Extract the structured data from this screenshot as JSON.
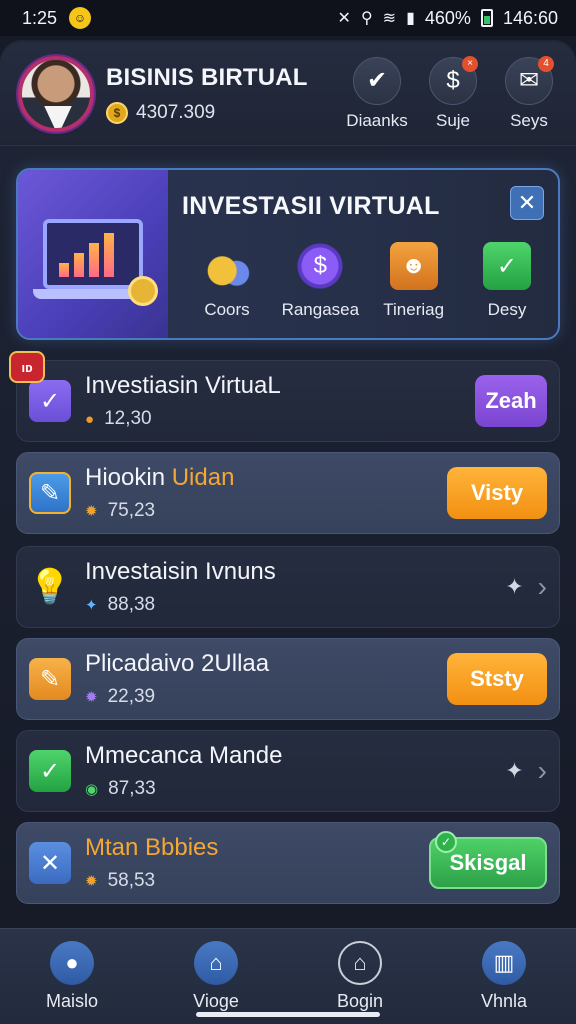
{
  "status_bar": {
    "time_left": "1:25",
    "battery_percent": "460%",
    "time_right": "146:60"
  },
  "header": {
    "name": "BISINIS BIRTUAL",
    "balance": "4307.309",
    "actions": [
      {
        "label": "Diaanks",
        "icon": "check-icon"
      },
      {
        "label": "Suje",
        "icon": "chat-dollar-icon"
      },
      {
        "label": "Seys",
        "icon": "message-icon"
      }
    ]
  },
  "banner": {
    "title": "INVESTASII VIRTUAL",
    "items": [
      {
        "label": "Coors",
        "icon": "coins-icon"
      },
      {
        "label": "Rangasea",
        "icon": "dollar-badge-icon"
      },
      {
        "label": "Tineriag",
        "icon": "person-icon"
      },
      {
        "label": "Desy",
        "icon": "checkmark-icon"
      }
    ]
  },
  "tasks": [
    {
      "title": "Investiasin VirtuaL",
      "value": "12,30",
      "button": "Zeah",
      "corner_badge": "ıᴅ"
    },
    {
      "title_main": "Hiookin ",
      "title_accent": "Uidan",
      "value": "75,23",
      "button": "Visty"
    },
    {
      "title": "Investaisin Ivnuns",
      "value": "88,38"
    },
    {
      "title": "Plicadaivo 2Ullaa",
      "value": "22,39",
      "button": "Ststy"
    },
    {
      "title": "Mmecanca Mande",
      "value": "87,33"
    },
    {
      "title": "Mtan Bbbies",
      "value": "58,53",
      "button": "Skisgal"
    }
  ],
  "bottom_nav": [
    {
      "label": "Maislo",
      "icon": "globe-icon"
    },
    {
      "label": "Vioge",
      "icon": "home-icon"
    },
    {
      "label": "Bogin",
      "icon": "house-outline-icon"
    },
    {
      "label": "Vhnla",
      "icon": "building-icon"
    }
  ]
}
